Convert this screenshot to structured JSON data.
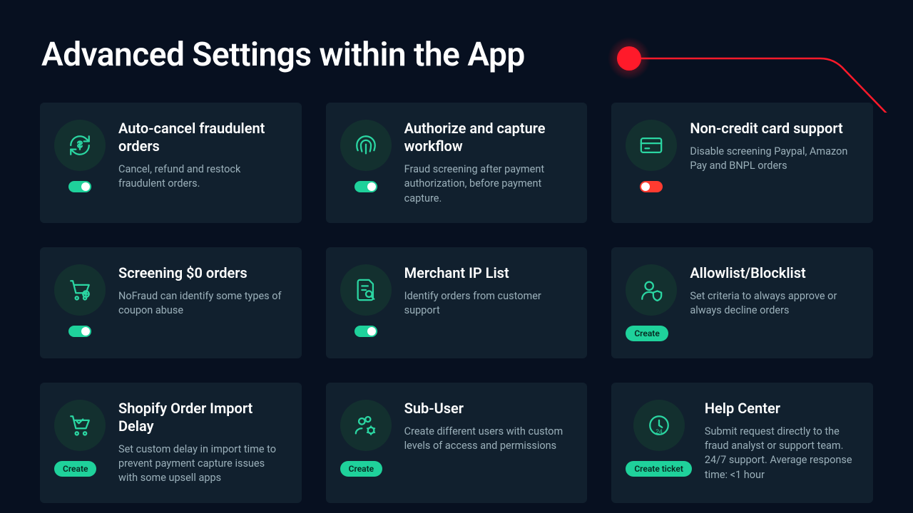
{
  "page_title": "Advanced Settings within the App",
  "colors": {
    "accent_green": "#1fd19b",
    "icon_green": "#2bd6a2",
    "accent_red": "#ff3b30",
    "bg": "#071020",
    "card_bg": "#11202e"
  },
  "cards": [
    {
      "icon": "refresh-dollar",
      "title": "Auto-cancel fraudulent orders",
      "desc": "Cancel, refund and restock fraudulent orders.",
      "control": "toggle",
      "state": "on"
    },
    {
      "icon": "fingerprint",
      "title": "Authorize and capture workflow",
      "desc": "Fraud screening after payment authorization, before payment capture.",
      "control": "toggle",
      "state": "on"
    },
    {
      "icon": "credit-card",
      "title": "Non-credit card support",
      "desc": "Disable screening Paypal, Amazon Pay and BNPL orders",
      "control": "toggle",
      "state": "off"
    },
    {
      "icon": "cart-plus",
      "title": "Screening $0 orders",
      "desc": "NoFraud can identify some types of coupon abuse",
      "control": "toggle",
      "state": "on"
    },
    {
      "icon": "doc-search",
      "title": "Merchant IP List",
      "desc": "Identify orders from customer support",
      "control": "toggle",
      "state": "on"
    },
    {
      "icon": "user-shield",
      "title": "Allowlist/Blocklist",
      "desc": "Set criteria to always approve or always decline orders",
      "control": "button",
      "button_label": "Create"
    },
    {
      "icon": "cart-check",
      "title": "Shopify Order Import Delay",
      "desc": "Set custom delay in import time to prevent payment capture issues with some upsell apps",
      "control": "button",
      "button_label": "Create"
    },
    {
      "icon": "users-gear",
      "title": "Sub-User",
      "desc": "Create different users with custom levels of access and permissions",
      "control": "button",
      "button_label": "Create"
    },
    {
      "icon": "clock-24",
      "title": "Help Center",
      "desc": "Submit request directly to the fraud analyst or support team. 24/7 support. Average response time: <1 hour",
      "control": "button",
      "button_label": "Create ticket"
    }
  ]
}
